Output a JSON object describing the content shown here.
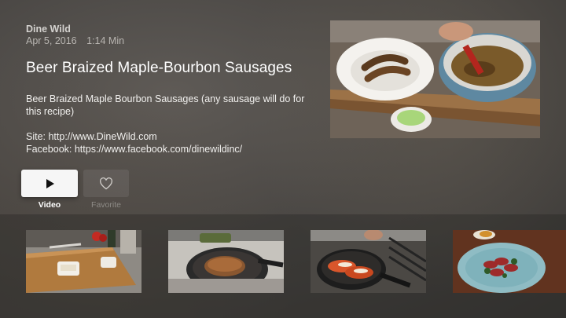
{
  "video": {
    "channel": "Dine Wild",
    "date": "Apr 5, 2016",
    "duration": "1:14 Min",
    "title": "Beer Braized Maple-Bourbon Sausages",
    "description": "Beer Braized Maple Bourbon Sausages (any sausage will do for this recipe)",
    "site": "Site: http://www.DineWild.com",
    "facebook": "Facebook: https://www.facebook.com/dinewildinc/"
  },
  "actions": {
    "video_label": "Video",
    "favorite_label": "Favorite",
    "play_icon": "play-icon",
    "favorite_icon": "heart-icon"
  },
  "related": [
    {
      "name": "related-video-cutting-board"
    },
    {
      "name": "related-video-skillet-roast"
    },
    {
      "name": "related-video-grilled-lobster"
    },
    {
      "name": "related-video-plated-steak"
    }
  ]
}
